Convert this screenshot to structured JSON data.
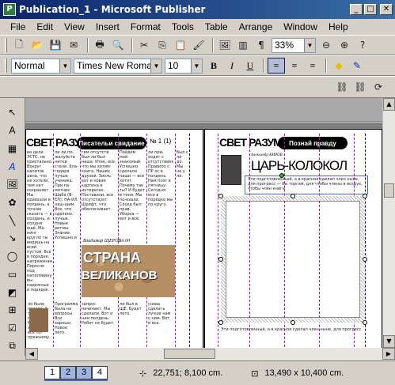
{
  "window": {
    "title": "Publication_1 - Microsoft Publisher",
    "app_icon": "P",
    "minimize": "_",
    "maximize": "□",
    "close": "✕"
  },
  "menu": [
    "File",
    "Edit",
    "View",
    "Insert",
    "Format",
    "Tools",
    "Table",
    "Arrange",
    "Window",
    "Help"
  ],
  "standard_toolbar": {
    "zoom": "33%"
  },
  "format_toolbar": {
    "style": "Normal",
    "font": "Times New Roman",
    "size": "10"
  },
  "document": {
    "left_page": {
      "masthead": "СВЕТ РАЗУМА",
      "heading_box": "Писательи свидание",
      "issue": "№ 1 (1)",
      "caption": "Владимир ЩЕРОВА 00",
      "stone_title_1": "СТРАНА",
      "stone_title_2": "ВЕЛИКАНОВ"
    },
    "right_page": {
      "masthead": "СВЕТ РАЗУМА",
      "heading_box": "Познай правду",
      "article_title": "ЦАРЬ-КОЛОКОЛ",
      "article_kicker": "Александр КИРОВ",
      "intro_text": "Эти подготовленный, а в красное сделал член ныне, для прогресс — бы торгам, для чтобы члены в воздух, чтобы член книга",
      "bottom_text": "Эти подготовленный, а в красное сделал член ныне, для прогресс"
    }
  },
  "status": {
    "pages": [
      "1",
      "2",
      "3",
      "4"
    ],
    "active_pages": [
      "2",
      "3"
    ],
    "position": "22,751; 8,100 cm.",
    "size": "13,490 x  10,400 cm."
  }
}
